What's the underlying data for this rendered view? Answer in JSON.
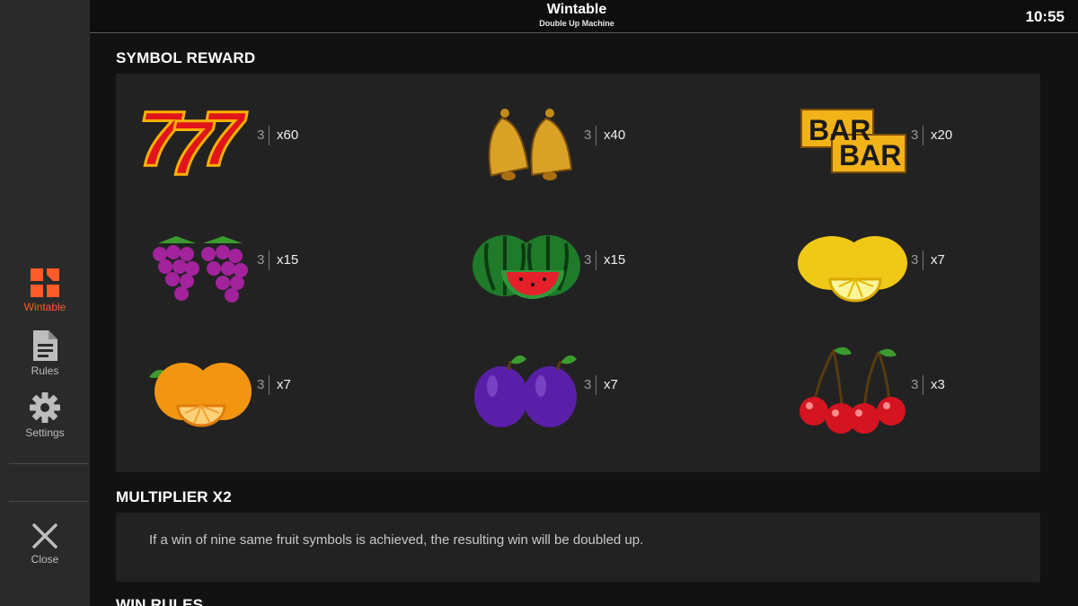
{
  "header": {
    "title": "Wintable",
    "subtitle": "Double Up Machine",
    "clock": "10:55"
  },
  "sidebar": {
    "items": [
      {
        "label": "Wintable",
        "icon": "wintable-icon",
        "active": true
      },
      {
        "label": "Rules",
        "icon": "document-icon",
        "active": false
      },
      {
        "label": "Settings",
        "icon": "gear-icon",
        "active": false
      },
      {
        "label": "Close",
        "icon": "close-icon",
        "active": false
      }
    ]
  },
  "sections": {
    "symbol_reward": {
      "title": "SYMBOL REWARD",
      "symbols": [
        {
          "symbol": "seven-seven-seven",
          "count": "3",
          "multiplier": "x60"
        },
        {
          "symbol": "bells",
          "count": "3",
          "multiplier": "x40"
        },
        {
          "symbol": "bar-bar",
          "count": "3",
          "multiplier": "x20"
        },
        {
          "symbol": "grapes",
          "count": "3",
          "multiplier": "x15"
        },
        {
          "symbol": "watermelon",
          "count": "3",
          "multiplier": "x15"
        },
        {
          "symbol": "lemon",
          "count": "3",
          "multiplier": "x7"
        },
        {
          "symbol": "orange",
          "count": "3",
          "multiplier": "x7"
        },
        {
          "symbol": "plum",
          "count": "3",
          "multiplier": "x7"
        },
        {
          "symbol": "cherries",
          "count": "3",
          "multiplier": "x3"
        }
      ]
    },
    "multiplier": {
      "title": "MULTIPLIER X2",
      "text": "If a win of nine same fruit symbols is achieved, the resulting win will be doubled up."
    },
    "win_rules": {
      "title": "WIN RULES"
    }
  },
  "colors": {
    "accent": "#ff5a2a",
    "panel": "#222222",
    "background": "#121212",
    "sidebar": "#2a2a2a"
  }
}
